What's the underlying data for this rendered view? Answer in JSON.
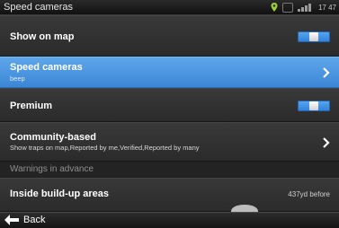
{
  "status_bar": {
    "title": "Speed cameras",
    "gps_icon": "gps-icon",
    "badge_text": "",
    "signal_text": "",
    "clock": "17 47"
  },
  "settings": {
    "show_on_map": {
      "label": "Show on map",
      "toggle_state": "on"
    },
    "speed_cameras": {
      "label": "Speed cameras",
      "sub": "beep"
    },
    "premium": {
      "label": "Premium",
      "toggle_state": "on"
    },
    "community": {
      "label": "Community-based",
      "sub": "Show traps on map,Reported by me,Verified,Reported by many"
    },
    "warnings_header": "Warnings in advance",
    "inside_buildup": {
      "label": "Inside build-up areas",
      "value": "437yd before"
    }
  },
  "bottom_bar": {
    "back_label": "Back"
  },
  "colors": {
    "accent": "#3c86d6",
    "background": "#1f1f1f",
    "toggle_on": "#2f7fd8"
  }
}
